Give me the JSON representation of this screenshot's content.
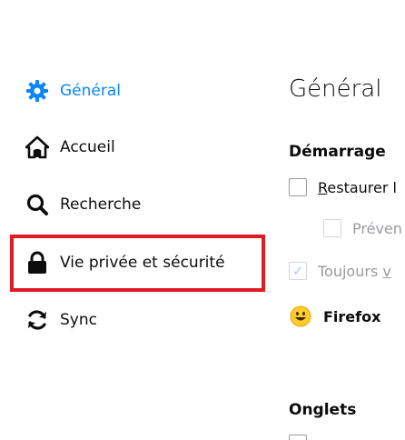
{
  "sidebar": {
    "items": [
      {
        "label": "Général",
        "icon": "gear-icon",
        "selected": true
      },
      {
        "label": "Accueil",
        "icon": "home-icon",
        "selected": false
      },
      {
        "label": "Recherche",
        "icon": "search-icon",
        "selected": false
      },
      {
        "label": "Vie privée et sécurité",
        "icon": "lock-icon",
        "selected": false
      },
      {
        "label": "Sync",
        "icon": "sync-icon",
        "selected": false
      }
    ],
    "highlight_color": "#e01b24",
    "accent_color": "#0a84ff"
  },
  "main": {
    "title": "Général",
    "startup": {
      "heading": "Démarrage",
      "restore_prefix": "R",
      "restore_rest": "estaurer l",
      "prevent_label": "Préven",
      "always_prefix": "Toujours ",
      "always_link": "v",
      "firefox_label": "Firefox"
    },
    "tabs": {
      "heading": "Onglets"
    }
  }
}
